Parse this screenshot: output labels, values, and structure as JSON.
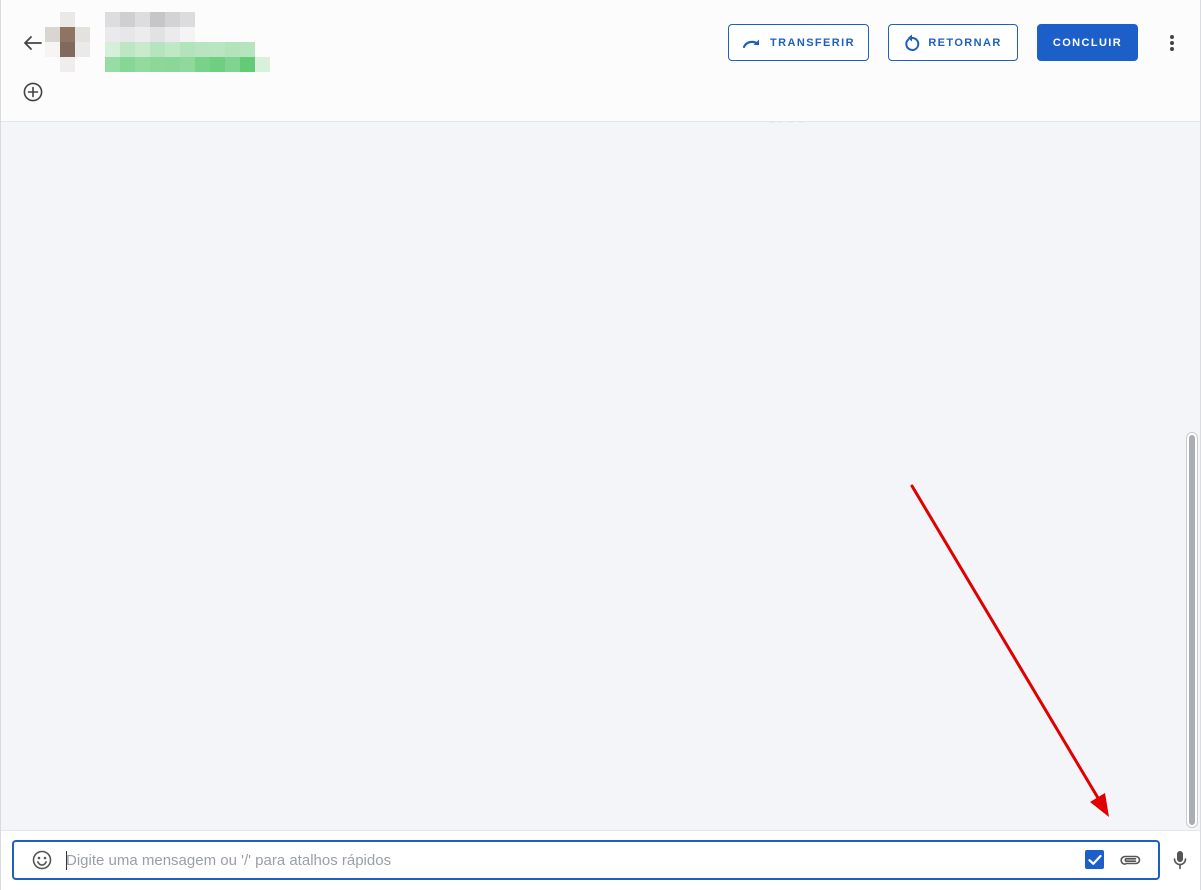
{
  "header": {
    "back_icon": "arrow-left-icon",
    "add_icon": "plus-circle-icon",
    "more_icon": "more-vert-icon",
    "contact": {
      "name": "",
      "phone": ""
    },
    "actions": {
      "transfer_label": "TRANSFERIR",
      "transfer_icon": "redo-arrow-icon",
      "return_label": "RETORNAR",
      "return_icon": "undo-circle-arrow-icon",
      "conclude_label": "CONCLUIR"
    }
  },
  "composer": {
    "placeholder": "Digite uma mensagem ou '/' para atalhos rápidos",
    "value": "",
    "emoji_icon": "emoji-smile-icon",
    "signature_checkbox_checked": true,
    "attach_icon": "paperclip-icon",
    "mic_icon": "microphone-icon"
  },
  "annotation": {
    "arrow_color": "#e00000"
  },
  "colors": {
    "accent": "#1c5fc9",
    "background": "#f4f5f8"
  }
}
